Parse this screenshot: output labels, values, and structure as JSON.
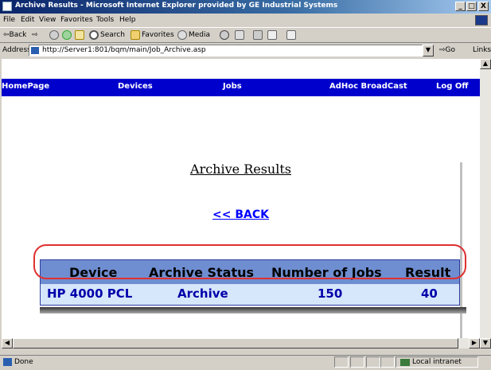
{
  "window": {
    "title": "Archive Results - Microsoft Internet Explorer provided by GE Industrial Systems",
    "controls": {
      "minimize": "_",
      "maximize": "□",
      "close": "X"
    }
  },
  "menu": [
    "File",
    "Edit",
    "View",
    "Favorites",
    "Tools",
    "Help"
  ],
  "toolbar": {
    "back": "⇦Back",
    "forward": "⇨",
    "search": "Search",
    "favorites": "Favorites",
    "media": "Media"
  },
  "address": {
    "label": "Address",
    "url": "http://Server1:801/bqm/main/Job_Archive.asp",
    "go": "Go",
    "links": "Links"
  },
  "nav": [
    "HomePage",
    "Devices",
    "Jobs",
    "AdHoc BroadCast",
    "Log Off"
  ],
  "page": {
    "heading": "Archive Results",
    "back_link": "<< BACK"
  },
  "table": {
    "headers": [
      "Device",
      "Archive Status",
      "Number of Jobs",
      "Result"
    ],
    "rows": [
      [
        "HP 4000 PCL",
        "Archive",
        "150",
        "40"
      ]
    ]
  },
  "status": {
    "text": "Done",
    "zone": "Local intranet"
  },
  "colors": {
    "nav_bg": "#0000cc",
    "table_header_bg": "#6f8ed1",
    "table_row_bg": "#d6e6fb",
    "highlight": "#e03030"
  }
}
